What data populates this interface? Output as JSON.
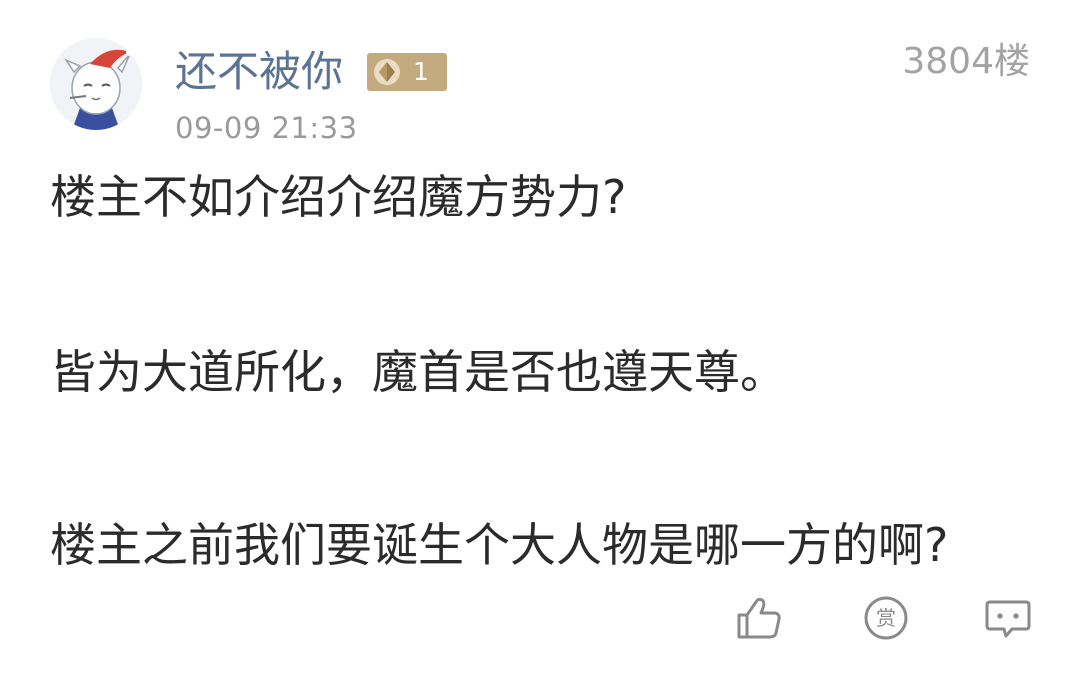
{
  "post": {
    "username": "还不被你",
    "level": "1",
    "timestamp": "09-09 21:33",
    "floor": "3804楼",
    "content": [
      "楼主不如介绍介绍魔方势力?",
      "皆为大道所化，魔首是否也遵天尊。",
      "楼主之前我们要诞生个大人物是哪一方的啊?"
    ]
  },
  "actions": {
    "like_icon": "thumbs-up-icon",
    "reward_icon": "reward-icon",
    "reward_glyph": "赏",
    "reply_icon": "comment-icon"
  },
  "colors": {
    "username": "#5d7394",
    "badge": "#c4ab7f",
    "meta": "#9a9a9a",
    "text": "#2b2b2b",
    "icon": "#8a8a8a"
  }
}
